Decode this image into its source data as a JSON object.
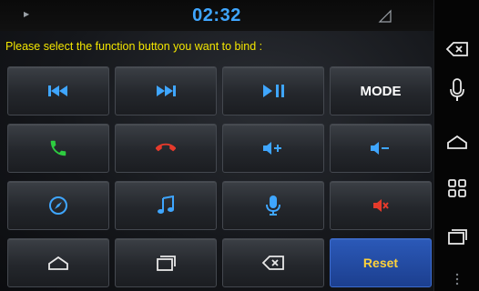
{
  "status_bar": {
    "time": "02:32",
    "left_icon": "notification-icon",
    "right_icon": "signal-icon"
  },
  "prompt_text": "Please select the function button you want to bind :",
  "buttons": [
    {
      "icon": "previous-track-icon",
      "label": ""
    },
    {
      "icon": "next-track-icon",
      "label": ""
    },
    {
      "icon": "play-pause-icon",
      "label": ""
    },
    {
      "icon": "",
      "label": "MODE"
    },
    {
      "icon": "call-answer-icon",
      "label": ""
    },
    {
      "icon": "call-hangup-icon",
      "label": ""
    },
    {
      "icon": "volume-up-icon",
      "label": ""
    },
    {
      "icon": "volume-down-icon",
      "label": ""
    },
    {
      "icon": "navigation-compass-icon",
      "label": ""
    },
    {
      "icon": "music-note-icon",
      "label": ""
    },
    {
      "icon": "microphone-icon",
      "label": ""
    },
    {
      "icon": "mute-icon",
      "label": ""
    },
    {
      "icon": "home-icon",
      "label": ""
    },
    {
      "icon": "recent-apps-icon",
      "label": ""
    },
    {
      "icon": "back-icon",
      "label": ""
    },
    {
      "icon": "",
      "label": "Reset"
    }
  ],
  "side_bar": [
    "back-icon",
    "microphone-icon",
    "home-icon",
    "apps-grid-icon",
    "recent-apps-icon",
    "more-icon"
  ],
  "colors": {
    "accent_blue": "#3fa6ff",
    "prompt_yellow": "#f3e600",
    "answer_green": "#2ecc40",
    "hangup_red": "#e53a2b",
    "reset_blue": "#2352b0",
    "reset_text": "#ffd23a"
  }
}
